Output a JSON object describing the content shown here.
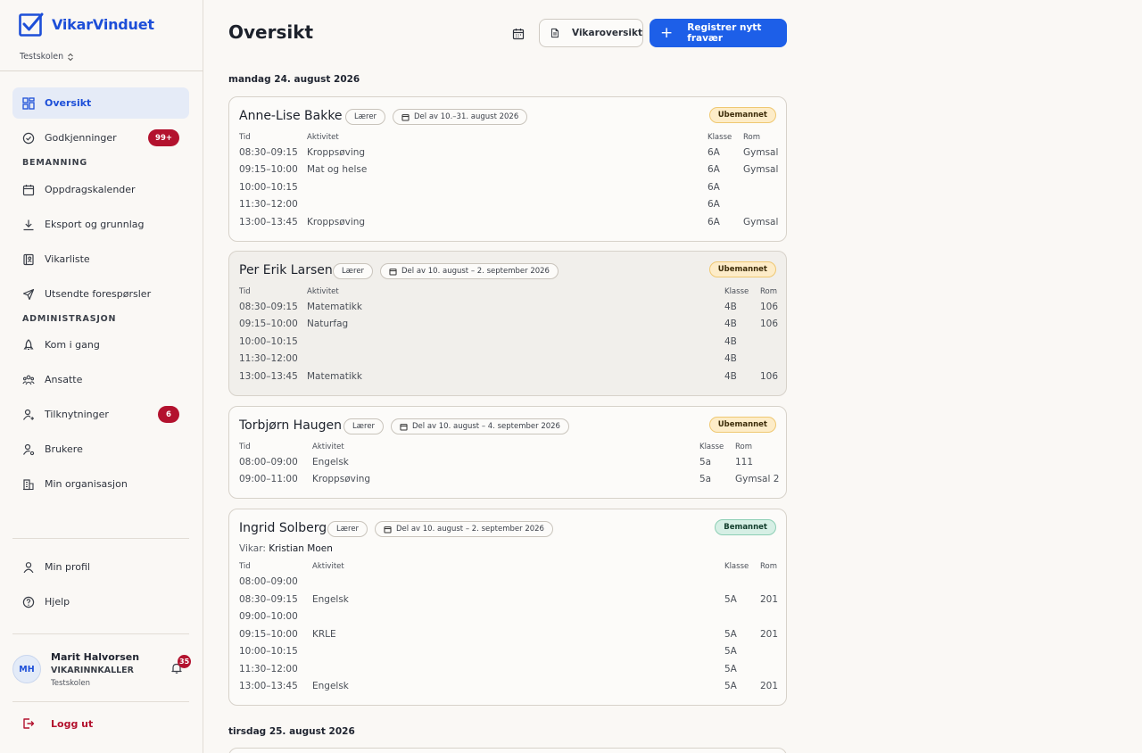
{
  "app": {
    "name": "VikarVinduet",
    "school": "Testskolen"
  },
  "sidebar": {
    "overview": "Oversikt",
    "approvals": "Godkjenninger",
    "approvals_badge": "99+",
    "section_staffing": "BEMANNING",
    "assignment_calendar": "Oppdragskalender",
    "export": "Eksport og grunnlag",
    "sub_list": "Vikarliste",
    "sent_requests": "Utsendte forespørsler",
    "section_admin": "ADMINISTRASJON",
    "get_started": "Kom i gang",
    "employees": "Ansatte",
    "affiliations": "Tilknytninger",
    "affiliations_badge": "6",
    "users": "Brukere",
    "my_org": "Min organisasjon",
    "my_profile": "Min profil",
    "help": "Hjelp",
    "logout": "Logg ut"
  },
  "user": {
    "initials": "MH",
    "name": "Marit Halvorsen",
    "role": "VIKARINNKALLER",
    "school": "Testskolen",
    "notifications": "35"
  },
  "header": {
    "title": "Oversikt",
    "sub_overview": "Vikaroversikt",
    "register": "Registrer nytt fravær"
  },
  "columns": {
    "time": "Tid",
    "activity": "Aktivitet",
    "class": "Klasse",
    "room": "Rom"
  },
  "days": [
    {
      "heading": "mandag 24. august 2026"
    },
    {
      "heading": "tirsdag 25. august 2026"
    }
  ],
  "cards": [
    {
      "name": "Anne-Lise Bakke",
      "role": "Lærer",
      "period": "Del av 10.–31. august 2026",
      "status": "Ubemannet",
      "rows": [
        {
          "time": "08:30–09:15",
          "activity": "Kroppsøving",
          "class": "6A",
          "room": "Gymsal"
        },
        {
          "time": "09:15–10:00",
          "activity": "Mat og helse",
          "class": "6A",
          "room": "Gymsal"
        },
        {
          "time": "10:00–10:15",
          "activity": "",
          "class": "6A",
          "room": ""
        },
        {
          "time": "11:30–12:00",
          "activity": "",
          "class": "6A",
          "room": ""
        },
        {
          "time": "13:00–13:45",
          "activity": "Kroppsøving",
          "class": "6A",
          "room": "Gymsal"
        }
      ]
    },
    {
      "name": "Per Erik Larsen",
      "role": "Lærer",
      "period": "Del av 10. august – 2. september 2026",
      "status": "Ubemannet",
      "rows": [
        {
          "time": "08:30–09:15",
          "activity": "Matematikk",
          "class": "4B",
          "room": "106"
        },
        {
          "time": "09:15–10:00",
          "activity": "Naturfag",
          "class": "4B",
          "room": "106"
        },
        {
          "time": "10:00–10:15",
          "activity": "",
          "class": "4B",
          "room": ""
        },
        {
          "time": "11:30–12:00",
          "activity": "",
          "class": "4B",
          "room": ""
        },
        {
          "time": "13:00–13:45",
          "activity": "Matematikk",
          "class": "4B",
          "room": "106"
        }
      ]
    },
    {
      "name": "Torbjørn Haugen",
      "role": "Lærer",
      "period": "Del av 10. august – 4. september 2026",
      "status": "Ubemannet",
      "rows": [
        {
          "time": "08:00–09:00",
          "activity": "Engelsk",
          "class": "5a",
          "room": "111"
        },
        {
          "time": "09:00–11:00",
          "activity": "Kroppsøving",
          "class": "5a",
          "room": "Gymsal 2"
        }
      ]
    },
    {
      "name": "Ingrid Solberg",
      "role": "Lærer",
      "period": "Del av 10. august – 2. september 2026",
      "status": "Bemannet",
      "vikar_label": "Vikar:",
      "vikar_name": "Kristian Moen",
      "rows": [
        {
          "time": "08:00–09:00",
          "activity": "",
          "class": "",
          "room": ""
        },
        {
          "time": "08:30–09:15",
          "activity": "Engelsk",
          "class": "5A",
          "room": "201"
        },
        {
          "time": "09:00–10:00",
          "activity": "",
          "class": "",
          "room": ""
        },
        {
          "time": "09:15–10:00",
          "activity": "KRLE",
          "class": "5A",
          "room": "201"
        },
        {
          "time": "10:00–10:15",
          "activity": "",
          "class": "5A",
          "room": ""
        },
        {
          "time": "11:30–12:00",
          "activity": "",
          "class": "5A",
          "room": ""
        },
        {
          "time": "13:00–13:45",
          "activity": "Engelsk",
          "class": "5A",
          "room": "201"
        }
      ]
    }
  ]
}
